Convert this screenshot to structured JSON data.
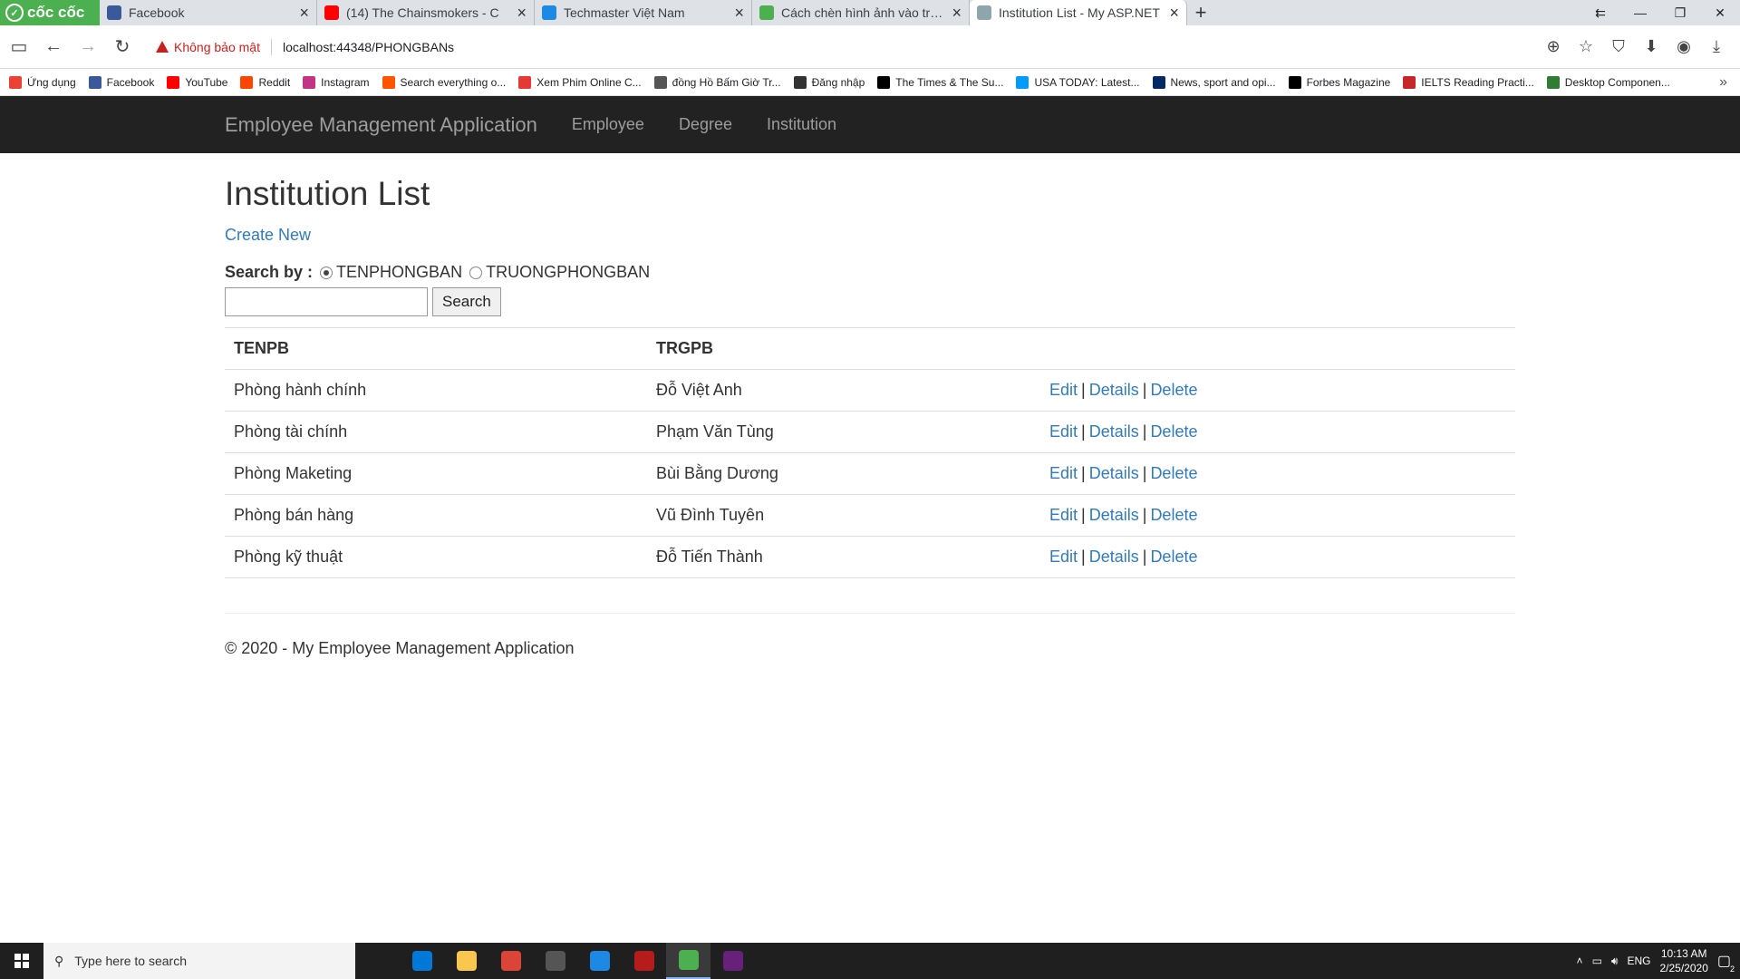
{
  "browser": {
    "logo_text": "cốc cốc",
    "tabs": [
      {
        "title": "Facebook",
        "icon": "facebook-icon",
        "color": "#3b5998"
      },
      {
        "title": "(14) The Chainsmokers - C",
        "icon": "youtube-icon",
        "color": "#ff0000"
      },
      {
        "title": "Techmaster Việt Nam",
        "icon": "techmaster-icon",
        "color": "#1e88e5"
      },
      {
        "title": "Cách chèn hình ảnh vào trang",
        "icon": "wordpress-icon",
        "color": "#4caf50"
      },
      {
        "title": "Institution List - My ASP.NET",
        "icon": "page-icon",
        "color": "#90a4ae"
      }
    ],
    "security_label": "Không bảo mật",
    "url": "localhost:44348/PHONGBANs",
    "bookmarks": [
      {
        "label": "Ứng dụng",
        "color": "#ea4335"
      },
      {
        "label": "Facebook",
        "color": "#3b5998"
      },
      {
        "label": "YouTube",
        "color": "#ff0000"
      },
      {
        "label": "Reddit",
        "color": "#ff4500"
      },
      {
        "label": "Instagram",
        "color": "#c13584"
      },
      {
        "label": "Search everything o...",
        "color": "#ff5500"
      },
      {
        "label": "Xem Phim Online C...",
        "color": "#e53935"
      },
      {
        "label": "đồng Hồ Bấm Giờ Tr...",
        "color": "#555555"
      },
      {
        "label": "Đăng nhập",
        "color": "#333333"
      },
      {
        "label": "The Times & The Su...",
        "color": "#000000"
      },
      {
        "label": "USA TODAY: Latest...",
        "color": "#009bff"
      },
      {
        "label": "News, sport and opi...",
        "color": "#052962"
      },
      {
        "label": "Forbes Magazine",
        "color": "#000000"
      },
      {
        "label": "IELTS Reading Practi...",
        "color": "#c62828"
      },
      {
        "label": "Desktop Componen...",
        "color": "#2e7d32"
      }
    ]
  },
  "site": {
    "brand": "Employee Management Application",
    "nav": [
      "Employee",
      "Degree",
      "Institution"
    ]
  },
  "main": {
    "title": "Institution List",
    "create_new": "Create New",
    "search_by_label": "Search by :",
    "radio_options": [
      {
        "label": "TENPHONGBAN",
        "checked": true
      },
      {
        "label": "TRUONGPHONGBAN",
        "checked": false
      }
    ],
    "search_value": "",
    "search_button": "Search",
    "table": {
      "headers": [
        "TENPB",
        "TRGPB",
        ""
      ],
      "rows": [
        {
          "tenpb": "Phòng hành chính",
          "trgpb": "Đỗ Việt Anh"
        },
        {
          "tenpb": "Phòng tài chính",
          "trgpb": "Phạm Văn Tùng"
        },
        {
          "tenpb": "Phòng Maketing",
          "trgpb": "Bùi Bằng Dương"
        },
        {
          "tenpb": "Phòng bán hàng",
          "trgpb": "Vũ Đình Tuyên"
        },
        {
          "tenpb": "Phòng kỹ thuật",
          "trgpb": "Đỗ Tiến Thành"
        }
      ],
      "actions": {
        "edit": "Edit",
        "details": "Details",
        "delete": "Delete",
        "separator": "|"
      }
    },
    "footer": "© 2020 - My Employee Management Application"
  },
  "taskbar": {
    "search_placeholder": "Type here to search",
    "apps": [
      {
        "name": "task-view-icon",
        "color": "#1f1f1f"
      },
      {
        "name": "edge-icon",
        "color": "#0078d7"
      },
      {
        "name": "file-explorer-icon",
        "color": "#f9c74f"
      },
      {
        "name": "chrome-icon",
        "color": "#db4437"
      },
      {
        "name": "camera-icon",
        "color": "#555555"
      },
      {
        "name": "browser-blue-icon",
        "color": "#1e88e5"
      },
      {
        "name": "game-icon",
        "color": "#b71c1c"
      },
      {
        "name": "coccoc-icon",
        "color": "#4caf50"
      },
      {
        "name": "visual-studio-icon",
        "color": "#68217a"
      }
    ],
    "lang": "ENG",
    "time": "10:13 AM",
    "date": "2/25/2020",
    "notifications": "2"
  }
}
